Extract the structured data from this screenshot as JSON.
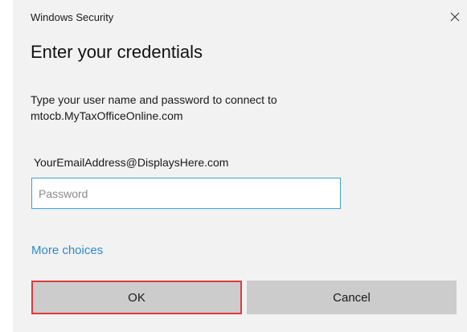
{
  "window": {
    "app_title": "Windows Security",
    "close_icon": "close-icon"
  },
  "dialog": {
    "heading": "Enter your credentials",
    "description_line1": "Type your user name and password to connect to",
    "description_line2": "mtocb.MyTaxOfficeOnline.com",
    "username": "YourEmailAddress@DisplaysHere.com",
    "password": {
      "value": "",
      "placeholder": "Password"
    },
    "more_choices": "More choices"
  },
  "buttons": {
    "ok_label": "OK",
    "cancel_label": "Cancel"
  },
  "colors": {
    "dialog_background": "#f2f2f2",
    "input_border": "#3ea1d8",
    "link": "#2b8ccb",
    "button_background": "#cccccc",
    "highlight_border": "#e0393e"
  }
}
